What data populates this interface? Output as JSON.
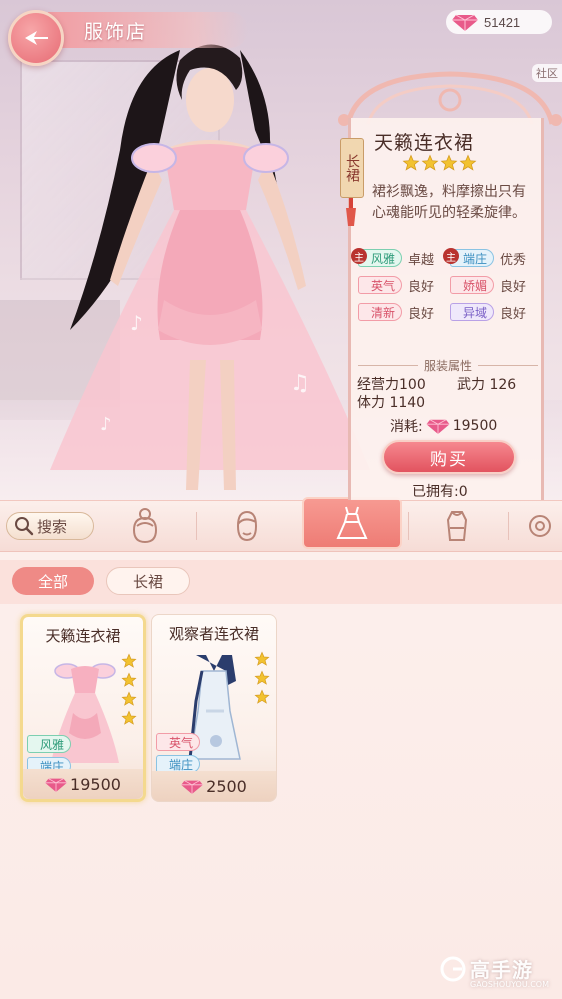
{
  "header": {
    "title": "服饰店",
    "gem_count": "51421",
    "community_label": "社区"
  },
  "item_detail": {
    "category_tag": "长裙",
    "name": "天籁连衣裙",
    "stars": 4,
    "description": "裙衫飘逸，料摩擦出只有心魂能听见的轻柔旋律。",
    "attributes": [
      [
        {
          "label": "风雅",
          "grade": "卓越",
          "main": true,
          "color": "green"
        },
        {
          "label": "端庄",
          "grade": "优秀",
          "main": true,
          "color": "blue"
        }
      ],
      [
        {
          "label": "英气",
          "grade": "良好",
          "main": false,
          "color": "red"
        },
        {
          "label": "娇媚",
          "grade": "良好",
          "main": false,
          "color": "red"
        }
      ],
      [
        {
          "label": "清新",
          "grade": "良好",
          "main": false,
          "color": "red"
        },
        {
          "label": "异域",
          "grade": "良好",
          "main": false,
          "color": "purple"
        }
      ]
    ],
    "section_title": "服装属性",
    "stats": {
      "business_label": "经营力",
      "business_value": "100",
      "force_label": "武力",
      "force_value": "126",
      "stamina_label": "体力",
      "stamina_value": "1140"
    },
    "cost_label": "消耗:",
    "cost_value": "19500",
    "buy_label": "购买",
    "owned_text": "已拥有:0"
  },
  "tabs": {
    "search_label": "搜索",
    "categories": [
      "hairstyle",
      "face",
      "dress",
      "clothes",
      "accessory"
    ],
    "active_index": 2
  },
  "filters": {
    "all_label": "全部",
    "dress_label": "长裙"
  },
  "cards": [
    {
      "name": "天籁连衣裙",
      "stars": 4,
      "tags": [
        {
          "label": "风雅",
          "color": "green"
        },
        {
          "label": "端庄",
          "color": "blue"
        }
      ],
      "price": "19500",
      "selected": true
    },
    {
      "name": "观察者连衣裙",
      "stars": 3,
      "tags": [
        {
          "label": "英气",
          "color": "red"
        },
        {
          "label": "端庄",
          "color": "blue"
        }
      ],
      "price": "2500",
      "selected": false
    }
  ],
  "watermark": {
    "brand": "高手游",
    "domain": "GAOSHOUYOU.COM"
  },
  "colors": {
    "accent": "#ee7c75",
    "buy_button": "#e2535f",
    "gold_star": "#f2c230",
    "gem": "#e85a8a"
  }
}
